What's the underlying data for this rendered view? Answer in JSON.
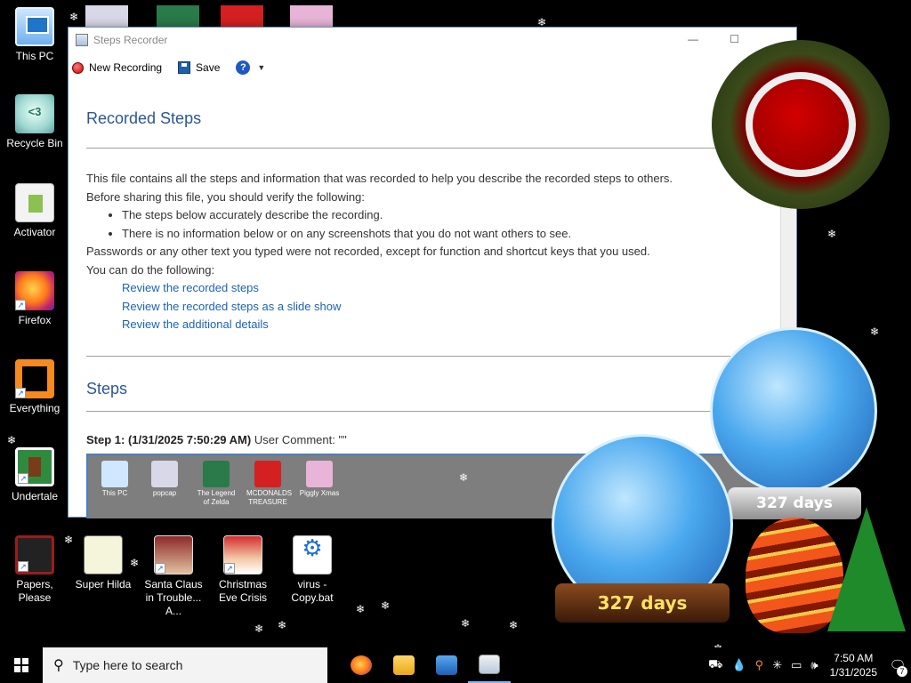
{
  "desktop": {
    "icons": [
      {
        "label": "This PC",
        "icon": "this-pc-icon"
      },
      {
        "label": "Recycle Bin",
        "icon": "recycle-bin-icon"
      },
      {
        "label": "Activator",
        "icon": "activator-icon"
      },
      {
        "label": "Firefox",
        "icon": "firefox-icon"
      },
      {
        "label": "Everything",
        "icon": "everything-icon"
      },
      {
        "label": "Undertale",
        "icon": "undertale-icon"
      },
      {
        "label": "Papers, Please",
        "icon": "papers-please-icon"
      },
      {
        "label": "Super Hilda",
        "icon": "super-hilda-icon"
      },
      {
        "label": "Santa Claus in Trouble... A...",
        "icon": "santa-claus-icon"
      },
      {
        "label": "Christmas Eve Crisis",
        "icon": "christmas-eve-icon"
      },
      {
        "label": "virus - Copy.bat",
        "icon": "batch-file-icon"
      }
    ]
  },
  "window": {
    "title": "Steps Recorder",
    "toolbar": {
      "new_recording": "New Recording",
      "save": "Save",
      "help_glyph": "?"
    },
    "content": {
      "heading": "Recorded Steps",
      "intro_line1": "This file contains all the steps and information that was recorded to help you describe the recorded steps to others.",
      "intro_line2": "Before sharing this file, you should verify the following:",
      "bullets": [
        "The steps below accurately describe the recording.",
        "There is no information below or on any screenshots that you do not want others to see."
      ],
      "intro_line3": "Passwords or any other text you typed were not recorded, except for function and shortcut keys that you used.",
      "intro_line4": "You can do the following:",
      "links": [
        "Review the recorded steps",
        "Review the recorded steps as a slide show",
        "Review the additional details"
      ],
      "steps_heading": "Steps",
      "step1_label": "Step 1: (1/31/2025 7:50:29 AM)",
      "step1_comment": "User Comment: \"\"",
      "screenshot_icons": [
        "This PC",
        "popcap",
        "The Legend of Zelda",
        "MCDONALDS TREASURE",
        "Piggly Xmas"
      ]
    }
  },
  "decor": {
    "globe_small_days": "327 days",
    "globe_large_days": "327 days"
  },
  "taskbar": {
    "search_placeholder": "Type here to search",
    "apps": [
      "firefox-icon",
      "file-explorer-icon",
      "network-users-icon",
      "steps-recorder-icon"
    ],
    "time": "7:50 AM",
    "date": "1/31/2025",
    "notification_count": "7"
  }
}
